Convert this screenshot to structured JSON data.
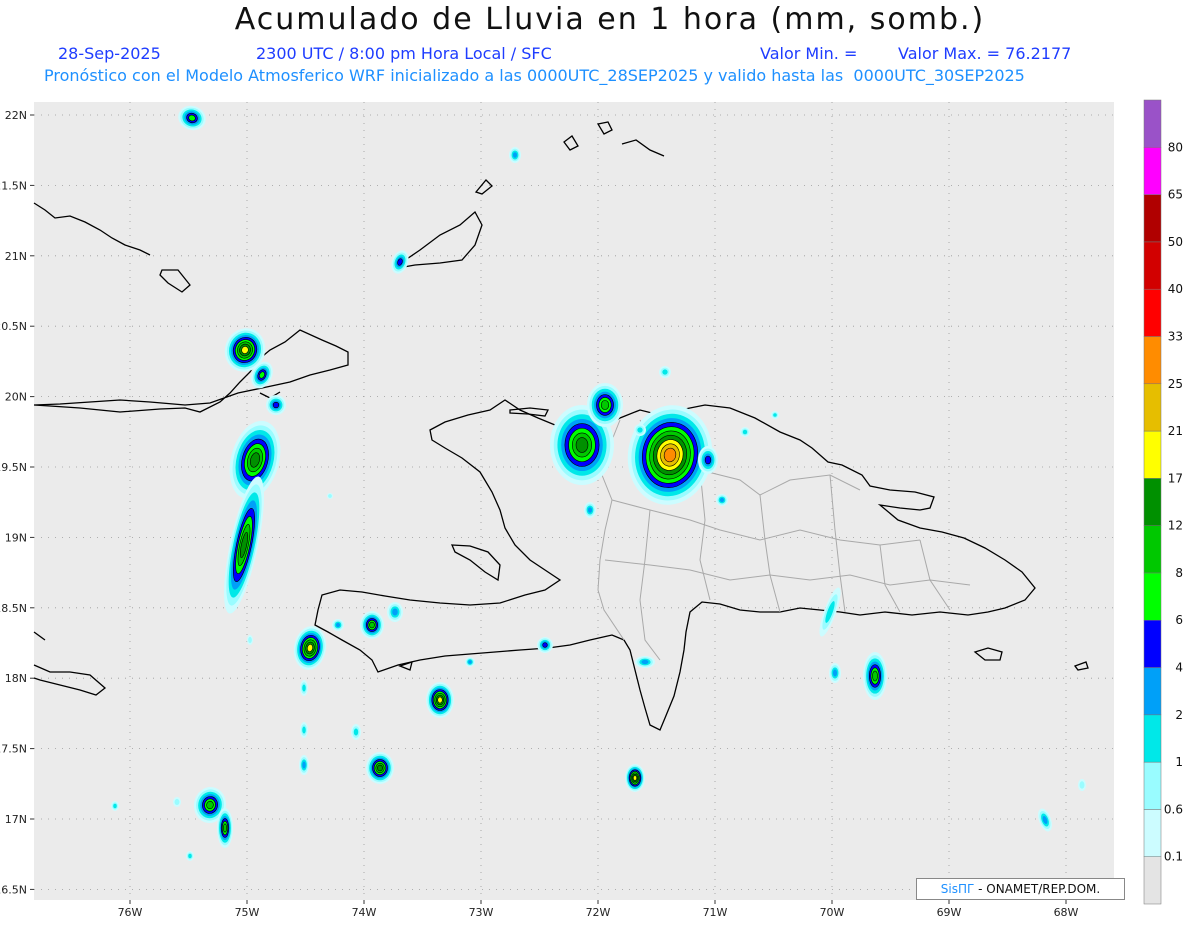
{
  "header": {
    "title": "Acumulado de Lluvia en 1 hora (mm, somb.)",
    "date": "28-Sep-2025",
    "time": "2300 UTC / 8:00 pm Hora Local / SFC",
    "valor_min": "Valor Min. =",
    "valor_max": "Valor Max. = 76.2177",
    "model_line": "Pronóstico con el Modelo Atmosferico WRF inicializado a las 0000UTC_28SEP2025 y valido hasta las  0000UTC_30SEP2025"
  },
  "map": {
    "lat_labels": [
      "22N",
      "21.5N",
      "21N",
      "20.5N",
      "20N",
      "19.5N",
      "19N",
      "18.5N",
      "18N",
      "17.5N",
      "17N",
      "16.5N"
    ],
    "lon_labels": [
      "76W",
      "75W",
      "74W",
      "73W",
      "72W",
      "71W",
      "70W",
      "69W",
      "68W"
    ],
    "background_color": "#ebebeb",
    "land_border_color": "#000000",
    "province_border_color": "#a9a9a9"
  },
  "colorbar": {
    "labels": [
      "0.1",
      "0.6",
      "1",
      "2",
      "4",
      "6",
      "8",
      "12",
      "17",
      "21",
      "25",
      "33",
      "40",
      "50",
      "65",
      "80"
    ],
    "colors": [
      "#e4e4e4",
      "#ccfcff",
      "#99fcff",
      "#00e8e8",
      "#00a0f8",
      "#0000ff",
      "#00ff00",
      "#00c800",
      "#009000",
      "#ffff00",
      "#e6be00",
      "#ff8c00",
      "#ff0000",
      "#d20000",
      "#b00000",
      "#ff00ff",
      "#9a52c8"
    ]
  },
  "credit": {
    "brand": "SisПГ",
    "text": " - ONAMET/REP.DOM."
  }
}
